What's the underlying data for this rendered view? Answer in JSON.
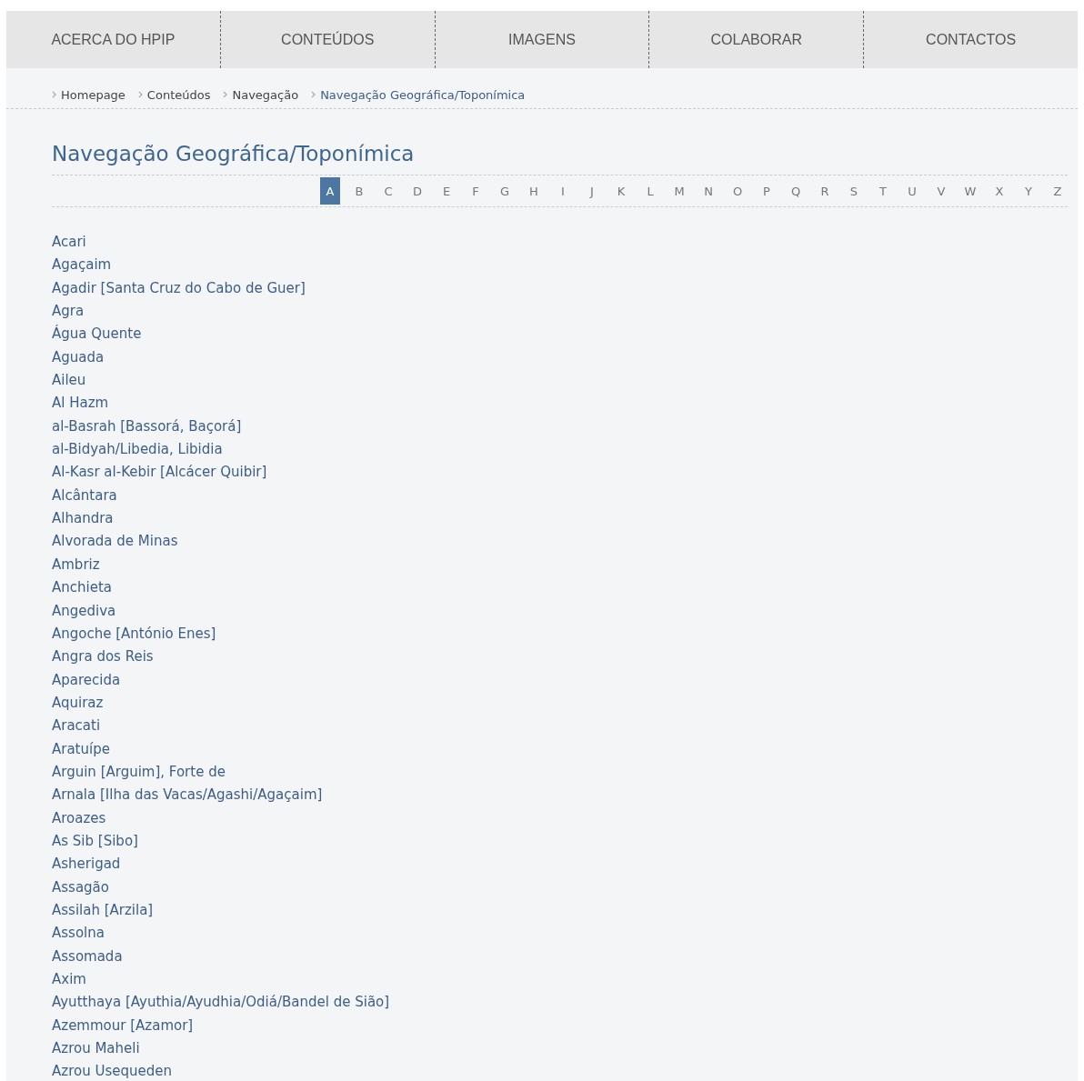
{
  "nav": [
    {
      "label": "ACERCA DO HPIP"
    },
    {
      "label": "CONTEÚDOS"
    },
    {
      "label": "IMAGENS"
    },
    {
      "label": "COLABORAR"
    },
    {
      "label": "CONTACTOS"
    }
  ],
  "breadcrumb": [
    {
      "label": "Homepage",
      "current": false
    },
    {
      "label": "Conteúdos",
      "current": false
    },
    {
      "label": "Navegação",
      "current": false
    },
    {
      "label": "Navegação Geográfica/Toponímica",
      "current": true
    }
  ],
  "title": "Navegação Geográfica/Toponímica",
  "letters": [
    {
      "label": "A",
      "selected": true
    },
    {
      "label": "B",
      "selected": false
    },
    {
      "label": "C",
      "selected": false
    },
    {
      "label": "D",
      "selected": false
    },
    {
      "label": "E",
      "selected": false
    },
    {
      "label": "F",
      "selected": false
    },
    {
      "label": "G",
      "selected": false
    },
    {
      "label": "H",
      "selected": false
    },
    {
      "label": "I",
      "selected": false
    },
    {
      "label": "J",
      "selected": false
    },
    {
      "label": "K",
      "selected": false
    },
    {
      "label": "L",
      "selected": false
    },
    {
      "label": "M",
      "selected": false
    },
    {
      "label": "N",
      "selected": false
    },
    {
      "label": "O",
      "selected": false
    },
    {
      "label": "P",
      "selected": false
    },
    {
      "label": "Q",
      "selected": false
    },
    {
      "label": "R",
      "selected": false
    },
    {
      "label": "S",
      "selected": false
    },
    {
      "label": "T",
      "selected": false
    },
    {
      "label": "U",
      "selected": false
    },
    {
      "label": "V",
      "selected": false
    },
    {
      "label": "W",
      "selected": false
    },
    {
      "label": "X",
      "selected": false
    },
    {
      "label": "Y",
      "selected": false
    },
    {
      "label": "Z",
      "selected": false
    }
  ],
  "places": [
    "Acari",
    "Agaçaim",
    "Agadir [Santa Cruz do Cabo de Guer]",
    "Agra",
    "Água Quente",
    "Aguada",
    "Aileu",
    "Al Hazm",
    "al-Basrah [Bassorá, Baçorá]",
    "al-Bidyah/Libedia, Libidia",
    "Al-Kasr al-Kebir [Alcácer Quibir]",
    "Alcântara",
    "Alhandra",
    "Alvorada de Minas",
    "Ambriz",
    "Anchieta",
    "Angediva",
    "Angoche [António Enes]",
    "Angra dos Reis",
    "Aparecida",
    "Aquiraz",
    "Aracati",
    "Aratuípe",
    "Arguin [Arguim], Forte de",
    "Arnala [Ilha das Vacas/Agashi/Agaçaim]",
    "Aroazes",
    "As Sib [Sibo]",
    "Asherigad",
    "Assagão",
    "Assilah [Arzila]",
    "Assolna",
    "Assomada",
    "Axim",
    "Ayutthaya [Ayuthia/Ayudhia/Odiá/Bandel de Sião]",
    "Azemmour [Azamor]",
    "Azrou Maheli",
    "Azrou Usequeden"
  ]
}
